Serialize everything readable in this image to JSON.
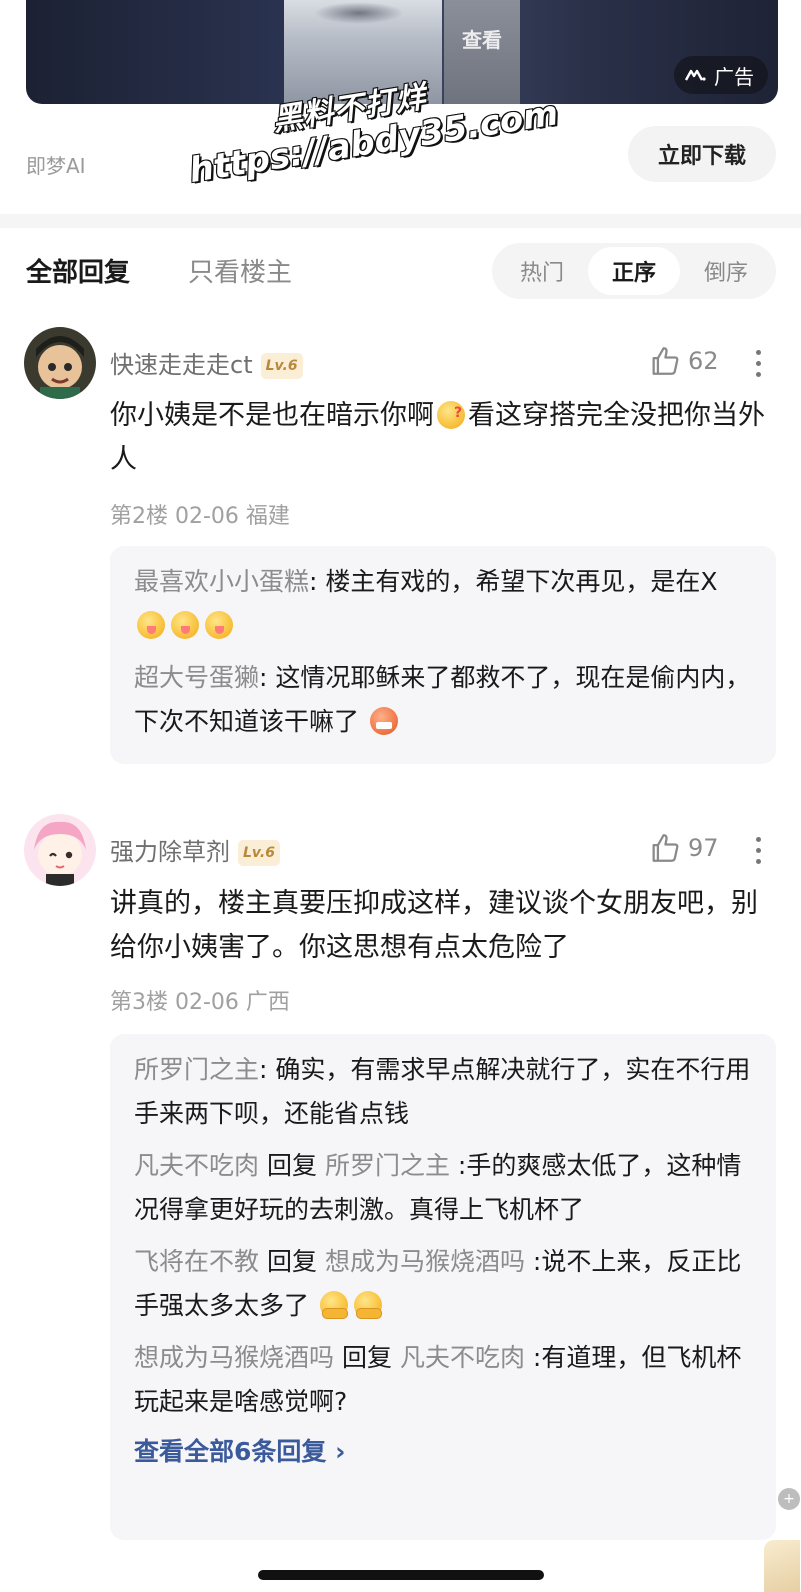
{
  "ad": {
    "view_label": "查看",
    "badge_label": "广告",
    "source": "即梦AI",
    "download_label": "立即下载"
  },
  "watermark": {
    "line1": "黑料不打烊",
    "line2": "https://abdy35.com"
  },
  "tabs": {
    "all": "全部回复",
    "op_only": "只看楼主",
    "sort": [
      "热门",
      "正序",
      "倒序"
    ],
    "sort_active": "正序"
  },
  "comments": [
    {
      "user": "快速走走走ct",
      "level": "Lv.6",
      "likes": "62",
      "text_part1": "你小姨是不是也在暗示你啊",
      "text_part2": "看这穿搭完全没把你当外人",
      "meta": "第2楼  02-06 福建",
      "replies": [
        {
          "name": "最喜欢小小蛋糕",
          "sep": ":",
          "text": "楼主有戏的，希望下次再见，是在X"
        },
        {
          "name": "超大号蛋獭",
          "sep": ":",
          "text": "这情况耶稣来了都救不了，现在是偷内内，下次不知道该干嘛了"
        }
      ]
    },
    {
      "user": "强力除草剂",
      "level": "Lv.6",
      "likes": "97",
      "text": "讲真的，楼主真要压抑成这样，建议谈个女朋友吧，别给你小姨害了。你这思想有点太危险了",
      "meta": "第3楼  02-06 广西",
      "replies": [
        {
          "name": "所罗门之主",
          "sep": ":",
          "text": "确实，有需求早点解决就行了，实在不行用手来两下呗，还能省点钱"
        },
        {
          "name": "凡夫不吃肉",
          "reply_word": "回复",
          "target": "所罗门之主",
          "sep": ":",
          "text": "手的爽感太低了，这种情况得拿更好玩的去刺激。真得上飞机杯了"
        },
        {
          "name": "飞将在不教",
          "reply_word": "回复",
          "target": "想成为马猴烧酒吗",
          "sep": ":",
          "text": "说不上来，反正比手强太多太多了"
        },
        {
          "name": "想成为马猴烧酒吗",
          "reply_word": "回复",
          "target": "凡夫不吃肉",
          "sep": ":",
          "text": "有道理，但飞机杯玩起来是啥感觉啊?"
        }
      ],
      "view_all": "查看全部6条回复 ›"
    }
  ],
  "colors": {
    "accent_link": "#3a5a9c",
    "level_badge_bg": "#fbeed6",
    "level_badge_text": "#b8893a"
  },
  "icons": [
    "thumb-up-icon",
    "more-vertical-icon",
    "ad-logo-icon"
  ]
}
